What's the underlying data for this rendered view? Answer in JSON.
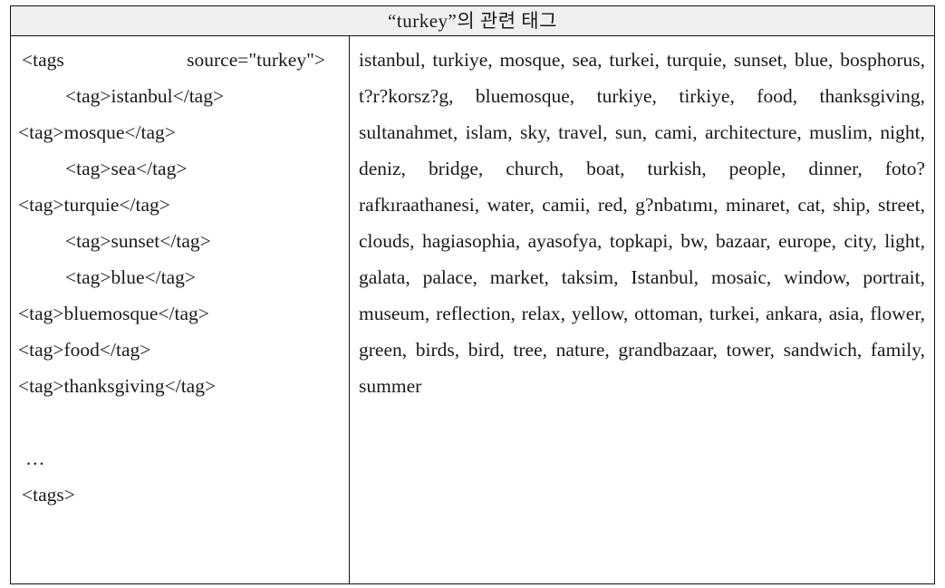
{
  "header": {
    "title": "“turkey”의 관련 태그"
  },
  "xml_column": {
    "name": "tag-xml-snippet",
    "lines": [
      {
        "text": "<tags    source=\"turkey\">",
        "style": "justified"
      },
      {
        "text": "<tag>istanbul</tag>",
        "style": "indent"
      },
      {
        "text": "<tag>mosque</tag>",
        "style": "flush"
      },
      {
        "text": "<tag>sea</tag>",
        "style": "indent"
      },
      {
        "text": "<tag>turquie</tag>",
        "style": "flush"
      },
      {
        "text": "<tag>sunset</tag>",
        "style": "indent"
      },
      {
        "text": "<tag>blue</tag>",
        "style": "indent"
      },
      {
        "text": "<tag>bluemosque</tag>",
        "style": "flush"
      },
      {
        "text": "<tag>food</tag>",
        "style": "flush"
      },
      {
        "text": "<tag>thanksgiving</tag>",
        "style": "flush"
      },
      {
        "text": "",
        "style": "blank"
      },
      {
        "text": "…",
        "style": "ellipsis"
      },
      {
        "text": "<tags>",
        "style": "closing"
      }
    ]
  },
  "tag_column": {
    "name": "related-tag-list",
    "tags": [
      "istanbul",
      "turkiye",
      "mosque",
      "sea",
      "turkei",
      "turquie",
      "sunset",
      "blue",
      "bosphorus",
      "t?r?korsz?g",
      "bluemosque",
      "turkiye",
      "tirkiye",
      "food",
      "thanksgiving",
      "sultanahmet",
      "islam",
      "sky",
      "travel",
      "sun",
      "cami",
      "architecture",
      "muslim",
      "night",
      "deniz",
      "bridge",
      "church",
      "boat",
      "turkish",
      "people",
      "dinner",
      "foto?rafkıraathanesi",
      "water",
      "camii",
      "red",
      "g?nbatımı",
      "minaret",
      "cat",
      "ship",
      "street",
      "clouds",
      "hagiasophia",
      "ayasofya",
      "topkapi",
      "bw",
      "bazaar",
      "europe",
      "city",
      "light",
      "galata",
      "palace",
      "market",
      "taksim",
      "Istanbul",
      "mosaic",
      "window",
      "portrait",
      "museum",
      "reflection",
      "relax",
      "yellow",
      "ottoman",
      "turkei",
      "ankara",
      "asia",
      "flower",
      "green",
      "birds",
      "bird",
      "tree",
      "nature",
      "grandbazaar",
      "tower",
      "sandwich",
      "family",
      "summer"
    ],
    "separator": ", "
  },
  "colors": {
    "border": "#111111",
    "header_background": "#f0f0f0",
    "text": "#1a1a1a",
    "page_background": "#ffffff"
  }
}
